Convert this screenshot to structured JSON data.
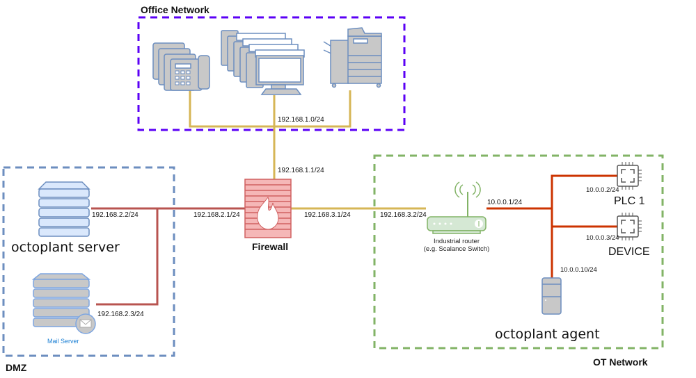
{
  "colors": {
    "office_border": "#5b00f5",
    "dmz_border": "#6c8ebf",
    "ot_border": "#82b366",
    "office_link": "#d6b656",
    "dmz_link": "#b85450",
    "ot_link": "#cc3300",
    "firewall": "#e07b7b",
    "router": "#97d077"
  },
  "zones": {
    "office": "Office Network",
    "dmz": "DMZ",
    "ot": "OT Network"
  },
  "office": {
    "subnet": "192.168.1.0/24",
    "devices": [
      "ip-phones-icon",
      "workstations-icon",
      "printer-icon"
    ]
  },
  "firewall": {
    "label": "Firewall",
    "ip_office": "192.168.1.1/24",
    "ip_dmz": "192.168.2.1/24",
    "ip_ot": "192.168.3.1/24"
  },
  "dmz": {
    "octoplant_server": {
      "label": "octoplant server",
      "ip": "192.168.2.2/24"
    },
    "mail_server": {
      "label": "Mail Server",
      "ip": "192.168.2.3/24"
    }
  },
  "ot": {
    "router": {
      "label_line1": "Industrial router",
      "label_line2": "(e.g. Scalance Switch)",
      "ip_uplink": "192.168.3.2/24",
      "ip_lan": "10.0.0.1/24"
    },
    "plc1": {
      "label": "PLC 1",
      "ip": "10.0.0.2/24"
    },
    "device": {
      "label": "DEVICE",
      "ip": "10.0.0.3/24"
    },
    "agent": {
      "label": "octoplant agent",
      "ip": "10.0.0.10/24"
    }
  }
}
